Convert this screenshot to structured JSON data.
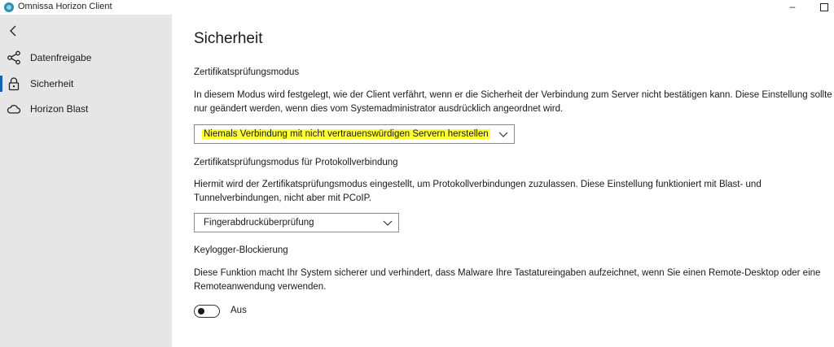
{
  "window": {
    "title": "Omnissa Horizon Client",
    "minimize_glyph": "–"
  },
  "sidebar": {
    "back_icon": "chevron-left-icon",
    "items": [
      {
        "label": "Datenfreigabe",
        "icon": "share-icon",
        "selected": false
      },
      {
        "label": "Sicherheit",
        "icon": "lock-icon",
        "selected": true
      },
      {
        "label": "Horizon Blast",
        "icon": "cloud-icon",
        "selected": false
      }
    ]
  },
  "main": {
    "title": "Sicherheit",
    "cert_mode": {
      "heading": "Zertifikatsprüfungsmodus",
      "desc_line1": "In diesem Modus wird festgelegt, wie der Client verfährt, wenn er die Sicherheit der Verbindung zum Server nicht bestätigen kann. Diese Einstellung sollte",
      "desc_line2": "nur geändert werden, wenn dies vom Systemadministrator ausdrücklich angeordnet wird.",
      "selected_value": "Niemals Verbindung mit nicht vertrauenswürdigen Servern herstellen",
      "highlight_color": "#ffff33"
    },
    "protocol_cert_mode": {
      "heading": "Zertifikatsprüfungsmodus für Protokollverbindung",
      "desc_line1": "Hiermit wird der Zertifikatsprüfungsmodus eingestellt, um Protokollverbindungen zuzulassen. Diese Einstellung funktioniert mit Blast- und",
      "desc_line2": "Tunnelverbindungen, nicht aber mit PCoIP.",
      "selected_value": "Fingerabdrucküberprüfung"
    },
    "keylogger": {
      "heading": "Keylogger-Blockierung",
      "desc_line1": "Diese Funktion macht Ihr System sicherer und verhindert, dass Malware Ihre Tastatureingaben aufzeichnet, wenn Sie einen Remote-Desktop oder eine",
      "desc_line2": "Remoteanwendung verwenden.",
      "toggle_state": "Aus"
    }
  },
  "colors": {
    "sidebar_bg": "#e6e6e6",
    "accent": "#1a5fb4"
  }
}
